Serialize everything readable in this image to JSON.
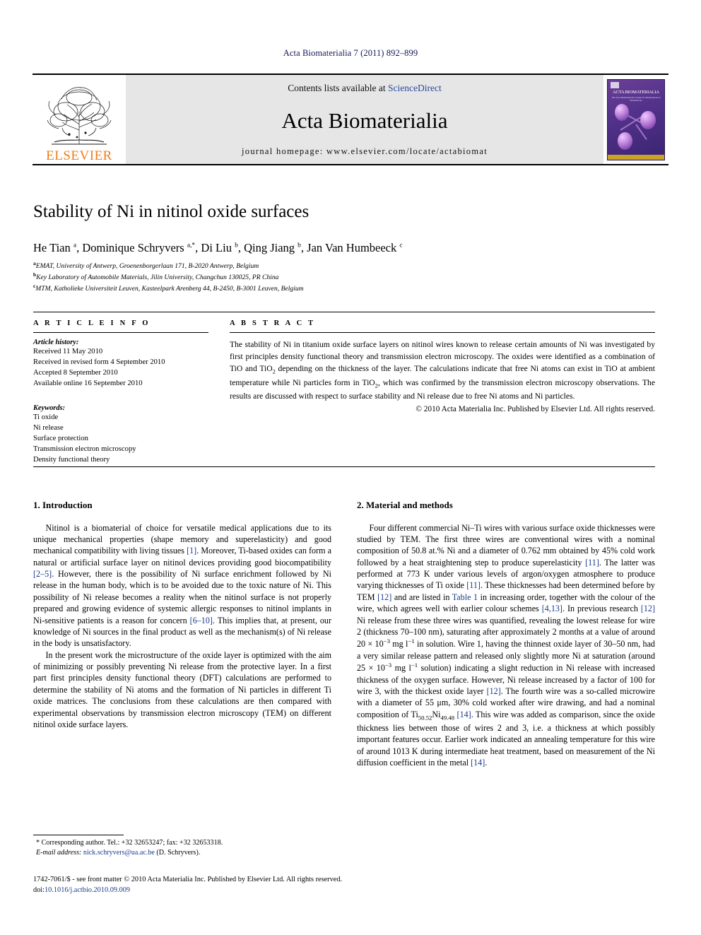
{
  "running_head": "Acta Biomaterialia 7 (2011) 892–899",
  "masthead": {
    "publisher_name": "ELSEVIER",
    "contents_prefix": "Contents lists available at ",
    "sciencedirect": "ScienceDirect",
    "journal_name": "Acta Biomaterialia",
    "homepage": "journal homepage: www.elsevier.com/locate/actabiomat",
    "cover_title": "ACTA BIOMATERIALIA",
    "cover_subtitle": "The Acta Biomaterialia Journal for Biomaterials in Biomedicals"
  },
  "article": {
    "title": "Stability of Ni in nitinol oxide surfaces",
    "authors_html": "He Tian <sup>a</sup>, Dominique Schryvers <sup>a,</sup><sup>*</sup>, Di Liu <sup>b</sup>, Qing Jiang <sup>b</sup>, Jan Van Humbeeck <sup>c</sup>",
    "affiliations": [
      {
        "marker": "a",
        "text": "EMAT, University of Antwerp, Groenenborgerlaan 171, B-2020 Antwerp, Belgium"
      },
      {
        "marker": "b",
        "text": "Key Laboratory of Automobile Materials, Jilin University, Changchun 130025, PR China"
      },
      {
        "marker": "c",
        "text": "MTM, Katholieke Universiteit Leuven, Kasteelpark Arenberg 44, B-2450, B-3001 Leuven, Belgium"
      }
    ]
  },
  "article_info": {
    "heading": "A R T I C L E   I N F O",
    "history_label": "Article history:",
    "history": [
      "Received 11 May 2010",
      "Received in revised form 4 September 2010",
      "Accepted 8 September 2010",
      "Available online 16 September 2010"
    ],
    "keywords_label": "Keywords:",
    "keywords": [
      "Ti oxide",
      "Ni release",
      "Surface protection",
      "Transmission electron microscopy",
      "Density functional theory"
    ]
  },
  "abstract": {
    "heading": "A B S T R A C T",
    "paragraph_html": "The stability of Ni in titanium oxide surface layers on nitinol wires known to release certain amounts of Ni was investigated by first principles density functional theory and transmission electron microscopy. The oxides were identified as a combination of TiO and TiO<sub>2</sub> depending on the thickness of the layer. The calculations indicate that free Ni atoms can exist in TiO at ambient temperature while Ni particles form in TiO<sub>2</sub>, which was confirmed by the transmission electron microscopy observations. The results are discussed with respect to surface stability and Ni release due to free Ni atoms and Ni particles.",
    "copyright": "© 2010 Acta Materialia Inc. Published by Elsevier Ltd. All rights reserved."
  },
  "sections": {
    "introduction": {
      "heading": "1. Introduction",
      "paragraphs_html": [
        "Nitinol is a biomaterial of choice for versatile medical applications due to its unique mechanical properties (shape memory and superelasticity) and good mechanical compatibility with living tissues <span class=\"ref\">[1]</span>. Moreover, Ti-based oxides can form a natural or artificial surface layer on nitinol devices providing good biocompatibility <span class=\"ref\">[2–5]</span>. However, there is the possibility of Ni surface enrichment followed by Ni release in the human body, which is to be avoided due to the toxic nature of Ni. This possibility of Ni release becomes a reality when the nitinol surface is not properly prepared and growing evidence of systemic allergic responses to nitinol implants in Ni-sensitive patients is a reason for concern <span class=\"ref\">[6–10]</span>. This implies that, at present, our knowledge of Ni sources in the final product as well as the mechanism(s) of Ni release in the body is unsatisfactory.",
        "In the present work the microstructure of the oxide layer is optimized with the aim of minimizing or possibly preventing Ni release from the protective layer. In a first part first principles density functional theory (DFT) calculations are performed to determine the stability of Ni atoms and the formation of Ni particles in different Ti oxide matrices. The conclusions from these calculations are then compared with experimental observations by transmission electron microscopy (TEM) on different nitinol oxide surface layers."
      ]
    },
    "materials": {
      "heading": "2. Material and methods",
      "paragraphs_html": [
        "Four different commercial Ni–Ti wires with various surface oxide thicknesses were studied by TEM. The first three wires are conventional wires with a nominal composition of 50.8 at.% Ni and a diameter of 0.762 mm obtained by 45% cold work followed by a heat straightening step to produce superelasticity <span class=\"ref\">[11]</span>. The latter was performed at 773 K under various levels of argon/oxygen atmosphere to produce varying thicknesses of Ti oxide <span class=\"ref\">[11]</span>. These thicknesses had been determined before by TEM <span class=\"ref\">[12]</span> and are listed in <span class=\"ref\">Table 1</span> in increasing order, together with the colour of the wire, which agrees well with earlier colour schemes <span class=\"ref\">[4,13]</span>. In previous research <span class=\"ref\">[12]</span> Ni release from these three wires was quantified, revealing the lowest release for wire 2 (thickness 70–100 nm), saturating after approximately 2 months at a value of around 20 &times; 10<sup class=\"num\">−3</sup> mg l<sup class=\"num\">−1</sup> in solution. Wire 1, having the thinnest oxide layer of 30–50 nm, had a very similar release pattern and released only slightly more Ni at saturation (around 25 &times; 10<sup class=\"num\">−3</sup> mg l<sup class=\"num\">−1</sup> solution) indicating a slight reduction in Ni release with increased thickness of the oxygen surface. However, Ni release increased by a factor of 100 for wire 3, with the thickest oxide layer <span class=\"ref\">[12]</span>. The fourth wire was a so-called microwire with a diameter of 55 μm, 30% cold worked after wire drawing, and had a nominal composition of Ti<sub>50.52</sub>Ni<sub>49.48</sub> <span class=\"ref\">[14]</span>. This wire was added as comparison, since the oxide thickness lies between those of wires 2 and 3, i.e. a thickness at which possibly important features occur. Earlier work indicated an annealing temperature for this wire of around 1013 K during intermediate heat treatment, based on measurement of the Ni diffusion coefficient in the metal <span class=\"ref\">[14]</span>."
      ]
    }
  },
  "footnote": {
    "corresponding_line": "* Corresponding author. Tel.: +32 32653247; fax: +32 32653318.",
    "email_label": "E-mail address:",
    "email": "nick.schryvers@ua.ac.be",
    "email_suffix": "(D. Schryvers)."
  },
  "footer": {
    "issn_line": "1742-7061/$ - see front matter © 2010 Acta Materialia Inc. Published by Elsevier Ltd. All rights reserved.",
    "doi_prefix": "doi:",
    "doi": "10.1016/j.actbio.2010.09.009"
  },
  "colors": {
    "link_blue": "#1b3a8c",
    "elsevier_orange": "#f07d1a",
    "masthead_gray": "#e6e6e6"
  }
}
